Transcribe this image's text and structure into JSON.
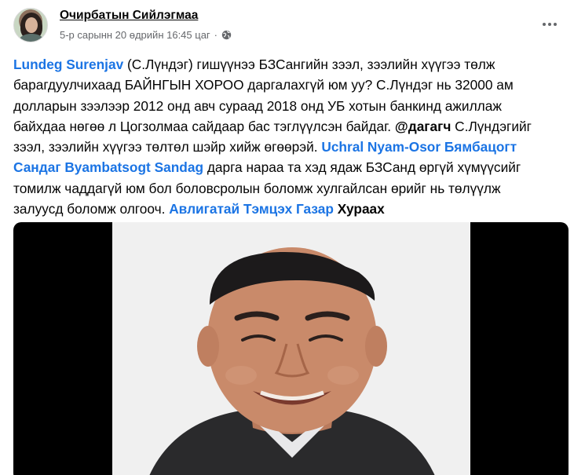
{
  "post": {
    "author": "Очирбатын Сийлэгмаа",
    "timestamp": "5-р сарынн 20 өдрийн 16:45 цаг",
    "separator": "·",
    "privacy_icon": "globe-icon",
    "more_icon": "more-options-icon",
    "colors": {
      "link": "#1b74e4",
      "text": "#050505",
      "meta": "#65676b"
    }
  },
  "content": {
    "l1_mention": "Lundeg Surenjav",
    "l1_text": " (С.Лүндэг) гишүүнээ БЗСангийн зээл, зээлийн хүүгээ төлж",
    "l2_text": "барагдуулчихаад БАЙНГЫН ХОРОО даргалахгүй юм уу? С.Лүндэг нь 32000 ам",
    "l3_text": "долларын зээлээр 2012 онд авч сураад 2018 онд  УБ хотын банкинд ажиллаж",
    "l4_text_a": "байхдаа нөгөө л Цогзолмаа сайдаар  бас тэглүүлсэн байдаг. ",
    "l4_tag": "@дагагч",
    "l4_text_b": " С.Лүндэгийг",
    "l5_text": "зээл, зээлийн хүүгээ төлтөл шэйр хийж өгөөрэй. ",
    "l5_mention": "Uchral Nyam-Osor Бямбацогт",
    "l6_mention": "Сандаг Byambatsogt Sandag",
    "l6_text": " дарга нараа та хэд ядаж БЗСанд өргүй хүмүүсийг",
    "l7_text": "томилж чаддагүй юм бол боловсролын боломж хулгайлсан өрийг нь төлүүлж",
    "l8_text": "залуусд боломж олгооч. ",
    "l8_mention": "Авлигатай Тэмцэх Газар",
    "l8_tail": " Хураах"
  },
  "media": {
    "photo": "portrait-photo",
    "colors": {
      "frame": "#000000",
      "background": "#f0f0f0",
      "skin": "#c98a6a",
      "hair": "#1c1a1b",
      "suit": "#2a2a2c"
    }
  }
}
